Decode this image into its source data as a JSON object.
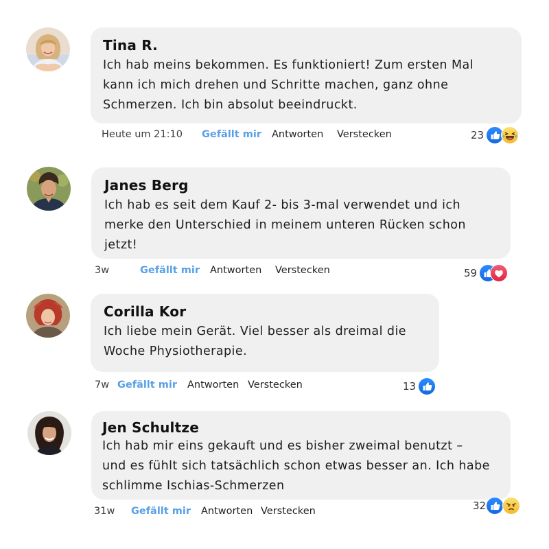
{
  "comments": [
    {
      "author": "Tina R.",
      "text": "Ich hab meins bekommen. Es funktioniert! Zum ersten Mal\nkann ich mich drehen und Schritte machen, ganz ohne\nSchmerzen. Ich bin absolut beeindruckt.",
      "time": "Heute um 21:10",
      "like_label": "Gefällt mir",
      "reply_label": "Antworten",
      "hide_label": "Verstecken",
      "reaction_count": "23",
      "reactions": [
        "like-icon",
        "laughing-emoji-icon"
      ],
      "avatar": "avatar-blonde-woman"
    },
    {
      "author": "Janes Berg",
      "text": "Ich hab es seit dem Kauf 2- bis 3-mal verwendet  und ich\nmerke den Unterschied in meinem unteren Rücken schon\njetzt!",
      "time": "3w",
      "like_label": "Gefällt mir",
      "reply_label": "Antworten",
      "hide_label": "Verstecken",
      "reaction_count": "59",
      "reactions": [
        "like-icon",
        "heart-icon"
      ],
      "avatar": "avatar-curly-man"
    },
    {
      "author": "Corilla Kor",
      "text": "Ich liebe mein Gerät. Viel besser als dreimal die\nWoche Physiotherapie.",
      "time": "7w",
      "like_label": "Gefällt mir",
      "reply_label": "Antworten",
      "hide_label": "Verstecken",
      "reaction_count": "13",
      "reactions": [
        "like-icon"
      ],
      "avatar": "avatar-redhead-woman"
    },
    {
      "author": "Jen Schultze",
      "text": "Ich hab mir eins gekauft und es bisher zweimal benutzt –\nund es fühlt sich tatsächlich schon etwas besser an. Ich habe\nschlimme Ischias-Schmerzen",
      "time": "31w",
      "like_label": "Gefällt mir",
      "reply_label": "Antworten",
      "hide_label": "Verstecken",
      "reaction_count": "32",
      "reactions": [
        "like-icon",
        "angry-emoji-icon"
      ],
      "avatar": "avatar-dark-hair-woman"
    }
  ],
  "colors": {
    "bubble": "#f0f0f0",
    "like_text": "#59a0e6",
    "like_icon": "#1877f2",
    "heart_icon": "#f33e58",
    "emoji": "#f7c948"
  }
}
